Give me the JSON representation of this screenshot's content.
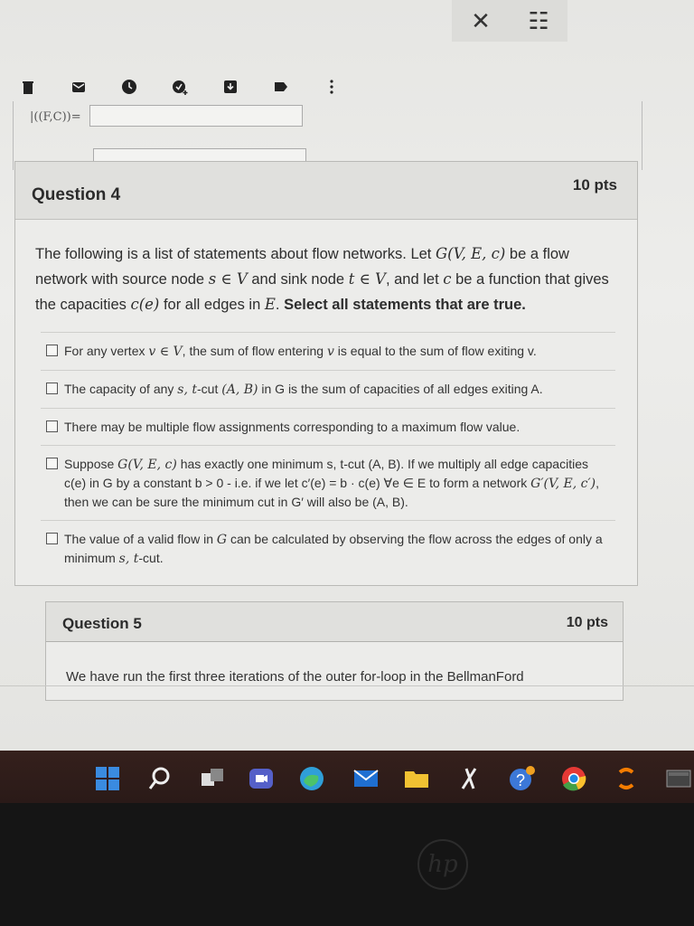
{
  "lens": {
    "close_glyph": "✕",
    "adjust_glyph": "☷"
  },
  "previous": {
    "formula_text": "|((F,C))="
  },
  "question4": {
    "title": "Question 4",
    "points": "10 pts",
    "body": {
      "p1": "The following is a list of statements about flow networks. Let ",
      "g": "G(V, E, c)",
      "p2": " be a flow network with source node ",
      "s": "s ∈ V",
      "p3": " and sink node ",
      "t": "t ∈ V",
      "p4": ", and let ",
      "c": "c",
      "p5": " be a function that gives the capacities ",
      "ce": "c(e)",
      "p6": " for all edges in ",
      "e": "E",
      "p7": ". ",
      "bold": "Select all statements that are true."
    },
    "options": [
      {
        "pre": "For any vertex ",
        "m1": "v ∈ V",
        "mid": ", the sum of flow entering ",
        "m2": "v",
        "post": " is equal to the sum of flow exiting v."
      },
      {
        "pre": "The capacity of any ",
        "m1": "s, t",
        "mid": "-cut ",
        "m2": "(A, B)",
        "post": " in G is the sum of capacities of all edges exiting A."
      },
      {
        "pre": "There may be multiple flow assignments corresponding to a maximum flow value.",
        "m1": "",
        "mid": "",
        "m2": "",
        "post": ""
      },
      {
        "pre": "Suppose ",
        "m1": "G(V, E, c)",
        "mid": " has exactly one minimum s, t-cut (A, B). If we multiply all edge capacities c(e) in G by a constant b > 0 - i.e. if we let c′(e) = b · c(e) ∀e ∈ E to form a network ",
        "m2": "G′(V, E, c′)",
        "post": ", then we can be sure the minimum cut in G′ will also be (A, B)."
      },
      {
        "pre": "The value of a valid flow in ",
        "m1": "G",
        "mid": " can be calculated by observing the flow across the edges of only a minimum ",
        "m2": "s, t",
        "post": "-cut."
      }
    ]
  },
  "question5": {
    "title": "Question 5",
    "points": "10 pts",
    "body": "We have run the first three iterations of the outer for-loop in the BellmanFord"
  },
  "bezel": {
    "logo_text": "hp"
  }
}
